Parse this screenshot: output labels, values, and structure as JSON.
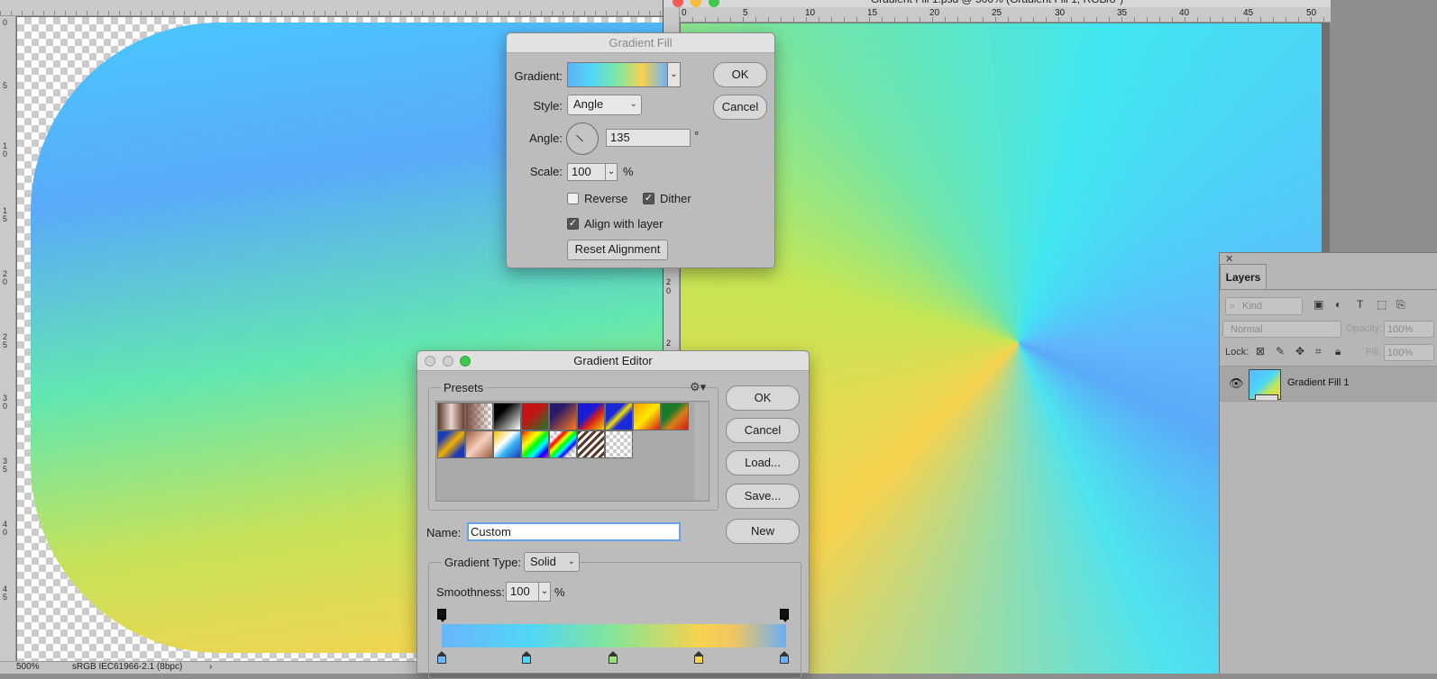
{
  "left_doc": {
    "ruler_side_marks": [
      "0",
      "5",
      "1 0",
      "1 5",
      "2 0",
      "2 5",
      "3 0",
      "3 5",
      "4 0",
      "4 5"
    ],
    "status": {
      "zoom": "500%",
      "profile": "sRGB IEC61966-2.1 (8bpc)",
      "arrow": "›"
    }
  },
  "right_doc": {
    "title": "Gradient Fill 1.psd @ 500% (Gradient Fill 1, RGB/8*)",
    "ruler_top_marks": [
      "0",
      "5",
      "10",
      "15",
      "20",
      "25",
      "30",
      "35",
      "40",
      "45",
      "50"
    ],
    "ruler_side_marks": [
      "2",
      "0",
      "2"
    ]
  },
  "gradient_fill": {
    "title": "Gradient Fill",
    "gradient_label": "Gradient:",
    "style_label": "Style:",
    "style_value": "Angle",
    "angle_label": "Angle:",
    "angle_value": "135",
    "angle_unit": "°",
    "scale_label": "Scale:",
    "scale_value": "100",
    "scale_unit": "%",
    "reverse_label": "Reverse",
    "reverse_checked": false,
    "dither_label": "Dither",
    "dither_checked": true,
    "align_label": "Align with layer",
    "align_checked": true,
    "reset_label": "Reset Alignment",
    "ok_label": "OK",
    "cancel_label": "Cancel"
  },
  "gradient_editor": {
    "title": "Gradient Editor",
    "presets_label": "Presets",
    "ok_label": "OK",
    "cancel_label": "Cancel",
    "load_label": "Load...",
    "save_label": "Save...",
    "name_label": "Name:",
    "name_value": "Custom",
    "new_label": "New",
    "gradient_type_label": "Gradient Type:",
    "gradient_type_value": "Solid",
    "smoothness_label": "Smoothness:",
    "smoothness_value": "100",
    "smoothness_unit": "%",
    "color_stops": [
      "#6ab6fa",
      "#4fd6f7",
      "#9be27c",
      "#f6d24e",
      "#6aaff5"
    ]
  },
  "layers": {
    "tab_label": "Layers",
    "filter_placeholder": "Kind",
    "blend_mode": "Normal",
    "opacity_label": "Opacity:",
    "opacity_value": "100%",
    "lock_label": "Lock:",
    "fill_label": "Fill:",
    "fill_value": "100%",
    "layer_name": "Gradient Fill 1"
  }
}
